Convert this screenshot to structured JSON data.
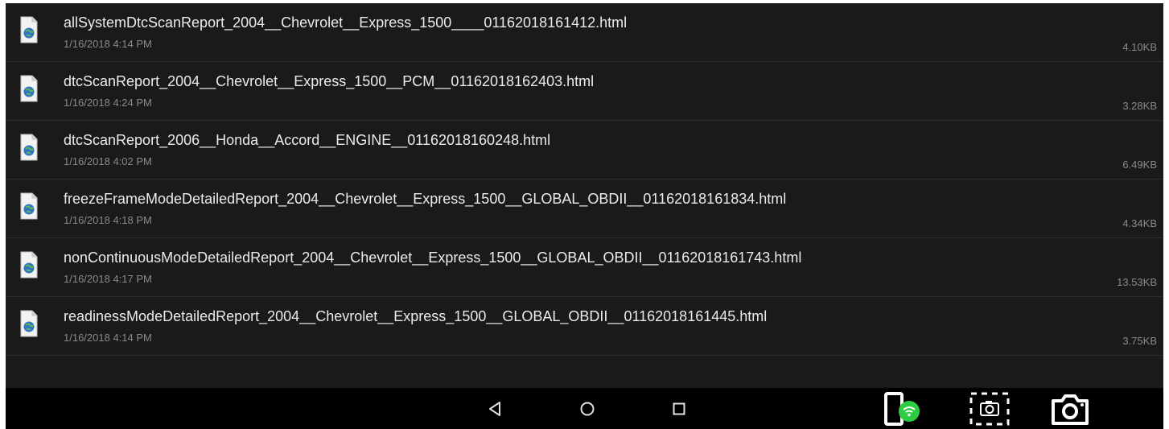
{
  "files": [
    {
      "name": "allSystemDtcScanReport_2004__Chevrolet__Express_1500____01162018161412.html",
      "date": "1/16/2018 4:14 PM",
      "size": "4.10KB"
    },
    {
      "name": "dtcScanReport_2004__Chevrolet__Express_1500__PCM__01162018162403.html",
      "date": "1/16/2018 4:24 PM",
      "size": "3.28KB"
    },
    {
      "name": "dtcScanReport_2006__Honda__Accord__ENGINE__01162018160248.html",
      "date": "1/16/2018 4:02 PM",
      "size": "6.49KB"
    },
    {
      "name": "freezeFrameModeDetailedReport_2004__Chevrolet__Express_1500__GLOBAL_OBDII__01162018161834.html",
      "date": "1/16/2018 4:18 PM",
      "size": "4.34KB"
    },
    {
      "name": "nonContinuousModeDetailedReport_2004__Chevrolet__Express_1500__GLOBAL_OBDII__01162018161743.html",
      "date": "1/16/2018 4:17 PM",
      "size": "13.53KB"
    },
    {
      "name": "readinessModeDetailedReport_2004__Chevrolet__Express_1500__GLOBAL_OBDII__01162018161445.html",
      "date": "1/16/2018 4:14 PM",
      "size": "3.75KB"
    }
  ],
  "icons": {
    "file": "html-file-globe-icon",
    "back": "back-triangle-icon",
    "home": "home-circle-icon",
    "recents": "recents-square-icon",
    "wifi_phone": "phone-wifi-icon",
    "screen_capture": "screen-capture-icon",
    "camera": "camera-icon"
  },
  "colors": {
    "background": "#1a1a1a",
    "navbar": "#000000",
    "text_primary": "#ebebeb",
    "text_secondary": "#8a8a8a",
    "wifi_badge": "#2ecc40"
  }
}
